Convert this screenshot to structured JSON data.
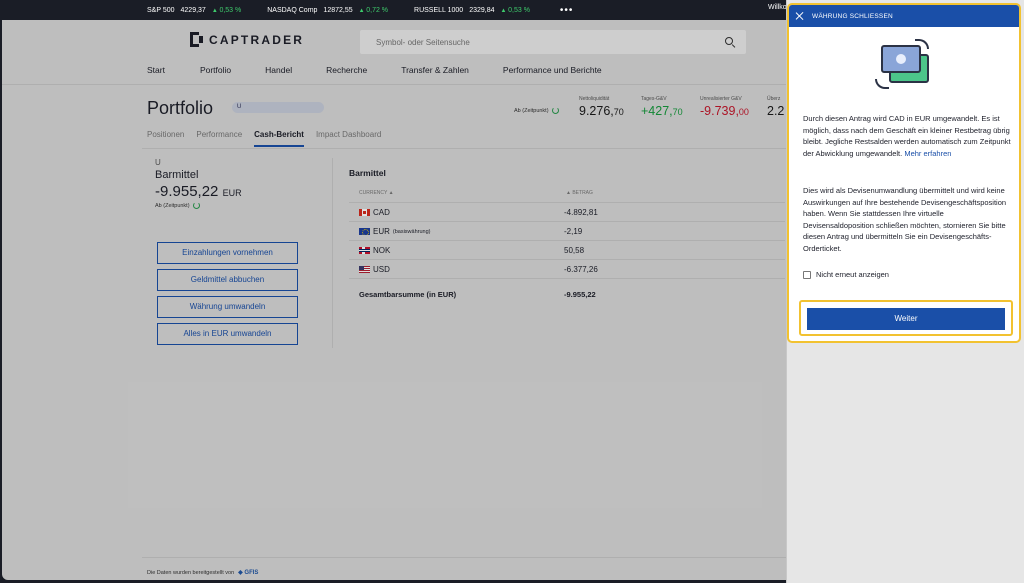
{
  "ticker": [
    {
      "name": "S&P 500",
      "value": "4229,37",
      "change": "0,53 %"
    },
    {
      "name": "NASDAQ Comp",
      "value": "12872,55",
      "change": "0,72 %"
    },
    {
      "name": "RUSSELL 1000",
      "value": "2329,84",
      "change": "0,53 %"
    }
  ],
  "ticker_more": "•••",
  "welcome": "Willko",
  "brand": "CAPTRADER",
  "search": {
    "placeholder": "Symbol- oder Seitensuche"
  },
  "nav": [
    "Start",
    "Portfolio",
    "Handel",
    "Recherche",
    "Transfer & Zahlen",
    "Performance und Berichte"
  ],
  "page_title": "Portfolio",
  "account_badge": "U",
  "as_of": "Ab (Zeitpunkt)",
  "kpis": [
    {
      "label": "Nettoliquidität",
      "value": "9.276,",
      "decimals": "70"
    },
    {
      "label": "Tages-G&V",
      "value": "+427,",
      "decimals": "70"
    },
    {
      "label": "Unrealisierter G&V",
      "value": "-9.739,",
      "decimals": "00"
    },
    {
      "label": "Überz",
      "value": "2.2",
      "decimals": ""
    }
  ],
  "subtabs": [
    "Positionen",
    "Performance",
    "Cash-Bericht",
    "Impact Dashboard"
  ],
  "active_subtab": "Cash-Bericht",
  "cash": {
    "account": "U",
    "title": "Barmittel",
    "value": "-9.955,22",
    "currency": "EUR",
    "as_of": "Ab (Zeitpunkt)",
    "buttons": [
      "Einzahlungen vornehmen",
      "Geldmittel abbuchen",
      "Währung umwandeln",
      "Alles in EUR umwandeln"
    ]
  },
  "table": {
    "title": "Barmittel",
    "headers": [
      "CURRENCY",
      "BETRAG"
    ],
    "rows": [
      {
        "flag": "ca",
        "currency": "CAD",
        "note": "",
        "amount": "-4.892,81"
      },
      {
        "flag": "eu",
        "currency": "EUR",
        "note": "(basiswährung)",
        "amount": "-2,19"
      },
      {
        "flag": "no",
        "currency": "NOK",
        "note": "",
        "amount": "50,58"
      },
      {
        "flag": "us",
        "currency": "USD",
        "note": "",
        "amount": "-6.377,26"
      }
    ],
    "total_label": "Gesamtbarsumme (in EUR)",
    "total_value": "-9.955,22"
  },
  "footer": {
    "text": "Die Daten wurden bereitgestellt von",
    "provider": "GFIS"
  },
  "dialog": {
    "header": "WÄHRUNG SCHLIESSEN",
    "p1": "Durch diesen Antrag wird CAD in EUR umgewandelt. Es ist möglich, dass nach dem Geschäft ein kleiner Restbetrag übrig bleibt. Jegliche Restsalden werden automatisch zum Zeitpunkt der Abwicklung umgewandelt.",
    "link": "Mehr erfahren",
    "p2": "Dies wird als Devisenumwandlung übermittelt und wird keine Auswirkungen auf Ihre bestehende Devisengeschäftsposition haben. Wenn Sie stattdessen Ihre virtuelle Devisensaldoposition schließen möchten, stornieren Sie bitte diesen Antrag und übermitteln Sie ein Devisengeschäfts-Orderticket.",
    "checkbox": "Nicht erneut anzeigen",
    "button": "Weiter"
  },
  "colors": {
    "accent": "#1a4fa8",
    "highlight": "#f2c230",
    "positive": "#169a3d",
    "negative": "#c4172c"
  }
}
